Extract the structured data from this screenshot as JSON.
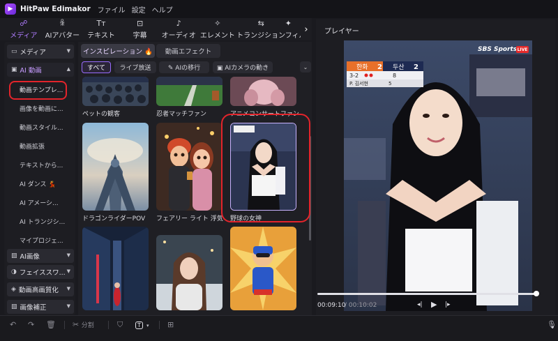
{
  "app": {
    "title": "HitPaw Edimakor",
    "menu": [
      "ファイル",
      "設定",
      "ヘルプ"
    ]
  },
  "top_tabs": [
    {
      "label": "メディア",
      "icon": "media-icon",
      "glyph": "☍",
      "active": true
    },
    {
      "label": "AIアバター",
      "icon": "avatar-icon",
      "glyph": "ꆜ",
      "active": false
    },
    {
      "label": "テキスト",
      "icon": "text-icon",
      "glyph": "Tт",
      "active": false
    },
    {
      "label": "字幕",
      "icon": "subtitle-icon",
      "glyph": "⊡",
      "active": false
    },
    {
      "label": "オーディオ",
      "icon": "audio-icon",
      "glyph": "♪",
      "active": false
    },
    {
      "label": "エレメント",
      "icon": "element-icon",
      "glyph": "✧",
      "active": false
    },
    {
      "label": "トランジション",
      "icon": "transition-icon",
      "glyph": "⇆",
      "active": false
    },
    {
      "label": "フィルタ",
      "icon": "filter-icon",
      "glyph": "✦",
      "active": false
    }
  ],
  "sidebar": {
    "groups": [
      {
        "label": "メディア",
        "icon": "folder-icon",
        "glyph": "▭",
        "open": false
      },
      {
        "label": "AI 動画",
        "icon": "ai-video-icon",
        "glyph": "▣",
        "open": true
      },
      {
        "label": "AI画像",
        "icon": "ai-image-icon",
        "glyph": "▨",
        "open": false
      },
      {
        "label": "フェイススワ...",
        "icon": "face-swap-icon",
        "glyph": "◑",
        "open": false
      },
      {
        "label": "動画高画質化",
        "icon": "enhance-icon",
        "glyph": "◈",
        "open": false
      },
      {
        "label": "画像補正",
        "icon": "image-fix-icon",
        "glyph": "▧",
        "open": false
      }
    ],
    "items": [
      {
        "label": "動画テンプレ...",
        "highlight": true
      },
      {
        "label": "画像を動画に..."
      },
      {
        "label": "動画スタイル..."
      },
      {
        "label": "動画拡張"
      },
      {
        "label": "テキストから..."
      },
      {
        "label": "AI ダンス 💃"
      },
      {
        "label": "AI アメーシ..."
      },
      {
        "label": "AI トランジシ..."
      },
      {
        "label": "マイプロジェ..."
      }
    ]
  },
  "content": {
    "subtabs": [
      {
        "label": "インスピレーション 🔥",
        "active": true
      },
      {
        "label": "動画エフェクト",
        "active": false
      }
    ],
    "chips": [
      {
        "label": "すべて",
        "active": true
      },
      {
        "label": "ライブ放送",
        "active": false
      },
      {
        "label": "✎ AIの移行",
        "active": false
      },
      {
        "label": "▣ AIカメラの動き",
        "active": false
      }
    ],
    "cards": [
      {
        "label": "ペットの観客"
      },
      {
        "label": "忍者マッチファン"
      },
      {
        "label": "アニメコンサートファン"
      },
      {
        "label": "ドラゴンライダーPOV"
      },
      {
        "label": "フェアリー ライト 浮気"
      },
      {
        "label": "野球の女神"
      },
      {
        "label": ""
      },
      {
        "label": ""
      },
      {
        "label": ""
      }
    ]
  },
  "player": {
    "title": "プレイヤー",
    "time_current": "00:09:10",
    "time_total": "/ 00:10:02",
    "progress": 0.998,
    "overlay": {
      "team1": "한화",
      "score1": "2",
      "team2": "두산",
      "score2": "2",
      "inning": "3-2",
      "count": "8",
      "player": "P. 김서현",
      "extra": "5",
      "broadcaster": "SBS Sports",
      "live": "LIVE"
    }
  },
  "bottom_toolbar": {
    "split": "分割"
  }
}
